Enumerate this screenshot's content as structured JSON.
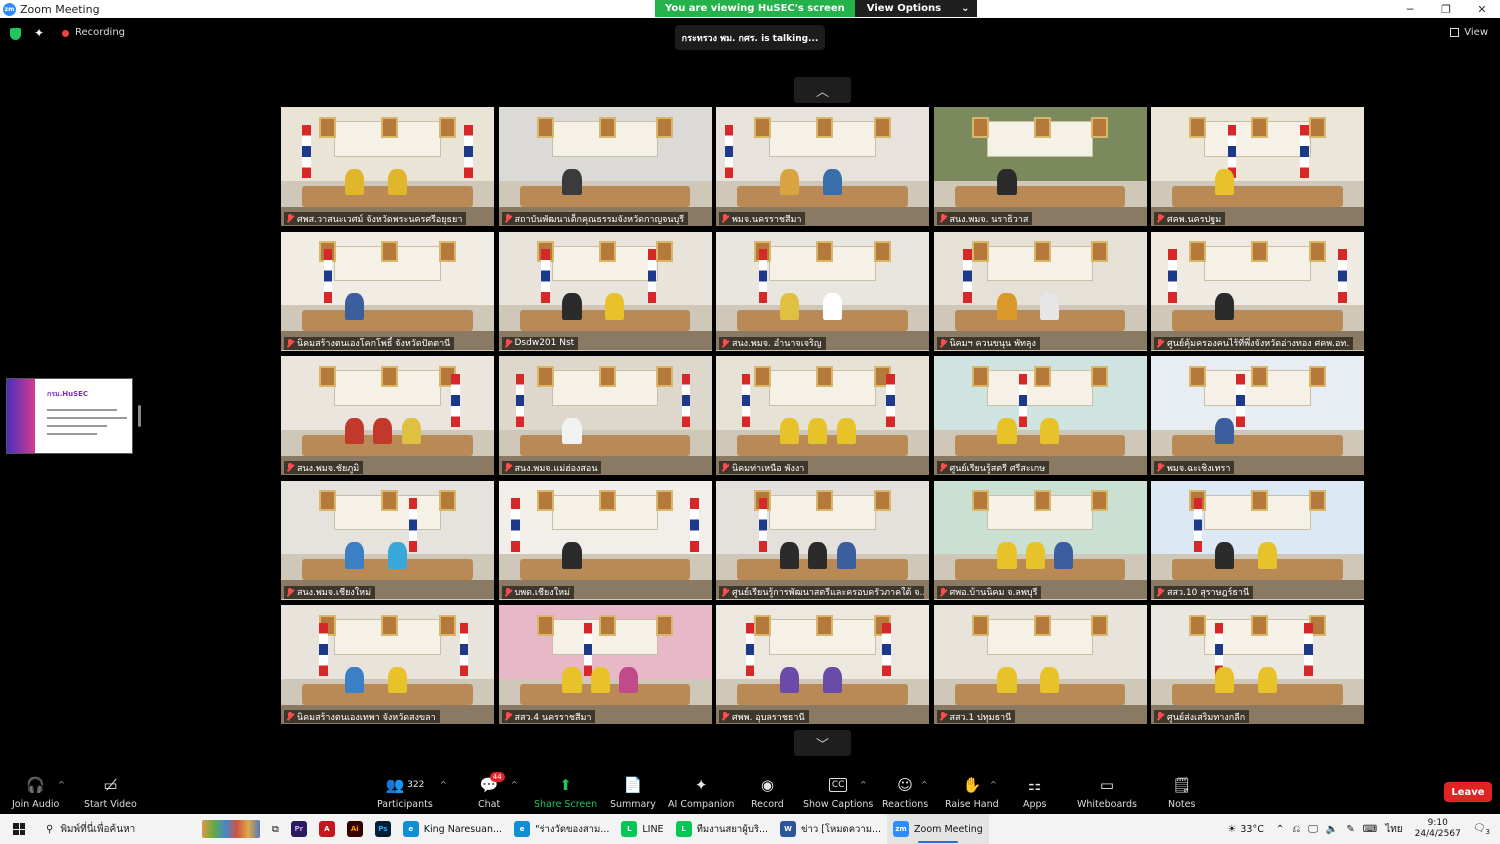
{
  "window": {
    "title": "Zoom Meeting",
    "logo": "zm",
    "controls": [
      "─",
      "❐",
      "✕"
    ]
  },
  "banner": {
    "viewing": "You are viewing HuSEC's screen",
    "options": "View Options"
  },
  "status": {
    "recording": "Recording",
    "view": "View",
    "talking": "กระทรวง พม. กศร. is  talking..."
  },
  "tiles": [
    {
      "name": "ศพส.วาสนะเวศม์ จังหวัดพระนครศรีอยุธยา",
      "wall": "#e9e4d6",
      "people": [
        "#e0b72a",
        "#e0b72a"
      ],
      "flags": [
        10,
        86
      ]
    },
    {
      "name": "สถาบันพัฒนาเด็กคุณธรรมจังหวัดกาญจนบุรี",
      "wall": "#dcdad6",
      "people": [
        "#3b3b3b"
      ],
      "flags": []
    },
    {
      "name": "พมจ.นครราชสีมา",
      "wall": "#e7e3dc",
      "people": [
        "#d9a441",
        "#3a6ea8"
      ],
      "flags": [
        4
      ]
    },
    {
      "name": "สนง.พมจ. นราธิวาส",
      "wall": "#7b8a5c",
      "people": [
        "#2b2b2b"
      ],
      "flags": []
    },
    {
      "name": "ศคพ.นครปฐม",
      "wall": "#ece6d9",
      "people": [
        "#e8c229"
      ],
      "flags": [
        36,
        70
      ]
    },
    {
      "name": "นิคมสร้างตนเองโคกโพธิ์ จังหวัดปัตตานี",
      "wall": "#f1ece4",
      "people": [
        "#3b5f9e"
      ],
      "flags": [
        20
      ]
    },
    {
      "name": "Dsdw201 Nst",
      "wall": "#e8e4dc",
      "people": [
        "#2b2b2b",
        "#e8c229"
      ],
      "flags": [
        20,
        70
      ]
    },
    {
      "name": "สนง.พมจ. อำนาจเจริญ",
      "wall": "#e9e5df",
      "people": [
        "#e0c040",
        "#ffffff"
      ],
      "flags": [
        20
      ]
    },
    {
      "name": "นิคมฯ ควนขนุน พัทลุง",
      "wall": "#e6e1d7",
      "people": [
        "#d99a2b",
        "#e6e6e6"
      ],
      "flags": [
        14
      ]
    },
    {
      "name": "ศูนย์คุ้มครองคนไร้ที่พึ่งจังหวัดอ่างทอง ศคพ.อท.",
      "wall": "#f0ebe2",
      "people": [
        "#2b2b2b"
      ],
      "flags": [
        8,
        88
      ]
    },
    {
      "name": "สนง.พมจ.ชัยภูมิ",
      "wall": "#ece5de",
      "people": [
        "#c0392b",
        "#c0392b",
        "#e0c040"
      ],
      "flags": [
        80
      ]
    },
    {
      "name": "สนง.พมจ.แม่ฮ่องสอน",
      "wall": "#ddd7cc",
      "people": [
        "#f2f2f2"
      ],
      "flags": [
        8,
        86
      ]
    },
    {
      "name": "นิคมท่าเหนือ พังงา",
      "wall": "#e7e2d6",
      "people": [
        "#e8c229",
        "#e8c229",
        "#e8c229"
      ],
      "flags": [
        12,
        80
      ]
    },
    {
      "name": "ศูนย์เรียนรู้สตรี ศรีสะเกษ",
      "wall": "#cfe3e0",
      "people": [
        "#e8c229",
        "#e8c229"
      ],
      "flags": [
        40
      ]
    },
    {
      "name": "พมจ.ฉะเชิงเทรา",
      "wall": "#e8edf3",
      "people": [
        "#3b5f9e"
      ],
      "flags": [
        40
      ]
    },
    {
      "name": "สนง.พมจ.เชียงใหม่",
      "wall": "#e6e3de",
      "people": [
        "#3b7fc4",
        "#3aa7d9"
      ],
      "flags": [
        60
      ]
    },
    {
      "name": "บพด.เชียงใหม่",
      "wall": "#f2efea",
      "people": [
        "#2b2b2b"
      ],
      "flags": [
        6,
        90
      ]
    },
    {
      "name": "ศูนย์เรียนรู้การพัฒนาสตรีและครอบครัวภาคใต้ จ...",
      "wall": "#e4e1dc",
      "people": [
        "#2b2b2b",
        "#2b2b2b",
        "#3b5f9e"
      ],
      "flags": [
        20
      ]
    },
    {
      "name": "ศพอ.บ้านนิคม จ.ลพบุรี",
      "wall": "#c9e0d2",
      "people": [
        "#e8c229",
        "#e8c229",
        "#3b5f9e"
      ],
      "flags": []
    },
    {
      "name": "สสว.10 สุราษฎร์ธานี",
      "wall": "#dce8f3",
      "people": [
        "#2b2b2b",
        "#e8c229"
      ],
      "flags": [
        20
      ]
    },
    {
      "name": "นิคมสร้างตนเองเทพา จังหวัดสงขลา",
      "wall": "#e8e4dc",
      "people": [
        "#3b7fc4",
        "#e8c229"
      ],
      "flags": [
        18,
        84
      ]
    },
    {
      "name": "สสว.4 นครราชสีมา",
      "wall": "#e7b8c8",
      "people": [
        "#e8c229",
        "#e8c229",
        "#c04a8a"
      ],
      "flags": [
        40
      ]
    },
    {
      "name": "ศพพ. อุบลราชธานี",
      "wall": "#ece8e0",
      "people": [
        "#6a4ca8",
        "#6a4ca8"
      ],
      "flags": [
        14,
        78
      ]
    },
    {
      "name": "สสว.1 ปทุมธานี",
      "wall": "#e8e4dc",
      "people": [
        "#e8c229",
        "#e8c229"
      ],
      "flags": []
    },
    {
      "name": "ศูนย์ส่งเสริมทางกลีก",
      "wall": "#eae7e0",
      "people": [
        "#e8c229",
        "#e8c229"
      ],
      "flags": [
        30,
        72
      ]
    }
  ],
  "share_thumb": {
    "logo": "กรม.HuSEC"
  },
  "toolbar": {
    "join_audio": "Join Audio",
    "start_video": "Start Video",
    "participants": "Participants",
    "participants_count": "322",
    "chat": "Chat",
    "chat_badge": "44",
    "share_screen": "Share Screen",
    "summary": "Summary",
    "ai_companion": "AI Companion",
    "record": "Record",
    "show_captions": "Show Captions",
    "reactions": "Reactions",
    "raise_hand": "Raise Hand",
    "apps": "Apps",
    "whiteboards": "Whiteboards",
    "notes": "Notes",
    "leave": "Leave",
    "accent_green": "#22c55e",
    "leave_red": "#e02424"
  },
  "taskbar": {
    "search_placeholder": "พิมพ์ที่นี่เพื่อค้นหา",
    "apps": [
      {
        "label": "King Naresuan...",
        "color": "#0f8ed6",
        "glyph": "e"
      },
      {
        "label": "\"ร่างวัดของสาม...",
        "color": "#0f8ed6",
        "glyph": "e"
      },
      {
        "label": "LINE",
        "color": "#06c755",
        "glyph": "L"
      },
      {
        "label": "ทีมงานสยาผู้บริ...",
        "color": "#06c755",
        "glyph": "L"
      },
      {
        "label": "ข่าว [โหมดความ...",
        "color": "#2b579a",
        "glyph": "W"
      },
      {
        "label": "Zoom Meeting",
        "color": "#2d8cff",
        "glyph": "zm"
      }
    ],
    "weather": "33°C",
    "lang": "ไทย",
    "time": "9:10",
    "date": "24/4/2567",
    "notif_count": "3"
  }
}
